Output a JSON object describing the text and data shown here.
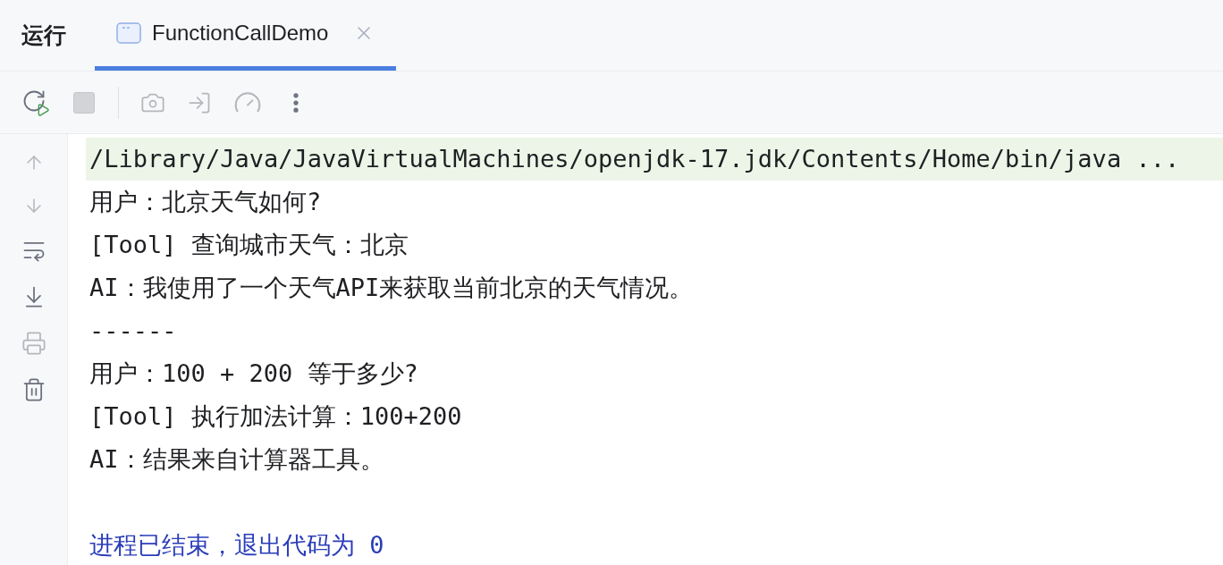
{
  "panel": {
    "title": "运行"
  },
  "tabs": [
    {
      "label": "FunctionCallDemo",
      "selected": true
    }
  ],
  "toolbar": [
    {
      "kind": "rerun",
      "disabled": false
    },
    {
      "kind": "stop",
      "disabled": true
    },
    {
      "kind": "separator",
      "disabled": false
    },
    {
      "kind": "camera",
      "disabled": true
    },
    {
      "kind": "login",
      "disabled": true
    },
    {
      "kind": "gauge",
      "disabled": true
    },
    {
      "kind": "more",
      "disabled": false
    }
  ],
  "side_toolbar": [
    {
      "kind": "up",
      "disabled": true
    },
    {
      "kind": "down",
      "disabled": true
    },
    {
      "kind": "wrap",
      "disabled": false
    },
    {
      "kind": "scroll_end",
      "disabled": false
    },
    {
      "kind": "print",
      "disabled": true
    },
    {
      "kind": "trash",
      "disabled": false
    }
  ],
  "console": [
    {
      "kind": "command",
      "text": "/Library/Java/JavaVirtualMachines/openjdk-17.jdk/Contents/Home/bin/java ..."
    },
    {
      "kind": "output",
      "text": "用户：北京天气如何?"
    },
    {
      "kind": "output",
      "text": "[Tool] 查询城市天气：北京"
    },
    {
      "kind": "output",
      "text": "AI：我使用了一个天气API来获取当前北京的天气情况。"
    },
    {
      "kind": "output",
      "text": "------"
    },
    {
      "kind": "output",
      "text": "用户：100 + 200 等于多少?"
    },
    {
      "kind": "output",
      "text": "[Tool] 执行加法计算：100+200"
    },
    {
      "kind": "output",
      "text": "AI：结果来自计算器工具。"
    },
    {
      "kind": "blank"
    },
    {
      "kind": "exit",
      "text": "进程已结束，退出代码为 0"
    }
  ]
}
